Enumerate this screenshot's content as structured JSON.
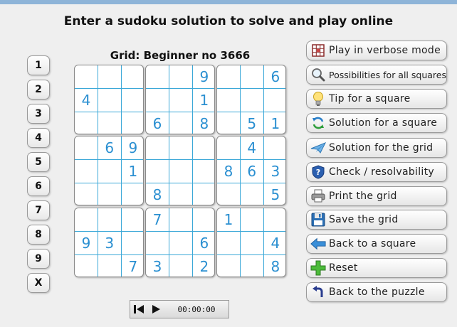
{
  "page": {
    "title": "Enter a sudoku solution to solve and play online"
  },
  "grid": {
    "title": "Grid: Beginner no 3666",
    "rows": [
      [
        "",
        "",
        "",
        "",
        "",
        "9",
        "",
        "",
        "6"
      ],
      [
        "4",
        "",
        "",
        "",
        "",
        "1",
        "",
        "",
        ""
      ],
      [
        "",
        "",
        "",
        "6",
        "",
        "8",
        "",
        "5",
        "1"
      ],
      [
        "",
        "6",
        "9",
        "",
        "",
        "",
        "",
        "4",
        ""
      ],
      [
        "",
        "",
        "1",
        "",
        "",
        "",
        "8",
        "6",
        "3"
      ],
      [
        "",
        "",
        "",
        "8",
        "",
        "",
        "",
        "",
        "5"
      ],
      [
        "",
        "",
        "",
        "7",
        "",
        "",
        "1",
        "",
        ""
      ],
      [
        "9",
        "3",
        "",
        "",
        "",
        "6",
        "",
        "",
        "4"
      ],
      [
        "",
        "",
        "7",
        "3",
        "",
        "2",
        "",
        "",
        "8"
      ]
    ],
    "digit_color": "#2a8fd1"
  },
  "numpad": [
    "1",
    "2",
    "3",
    "4",
    "5",
    "6",
    "7",
    "8",
    "9",
    "X"
  ],
  "actions": [
    {
      "label": "Play in verbose mode",
      "icon": "grid-icon",
      "name": "play-verbose-button"
    },
    {
      "label": "Possibilities for all squares",
      "icon": "magnifier-icon",
      "name": "possibilities-button"
    },
    {
      "label": "Tip for a square",
      "icon": "lightbulb-icon",
      "name": "tip-button"
    },
    {
      "label": "Solution for a square",
      "icon": "refresh-arrows-icon",
      "name": "solution-square-button"
    },
    {
      "label": "Solution for the grid",
      "icon": "paper-plane-icon",
      "name": "solution-grid-button"
    },
    {
      "label": "Check / resolvability",
      "icon": "shield-icon",
      "name": "check-button"
    },
    {
      "label": "Print the grid",
      "icon": "printer-icon",
      "name": "print-button"
    },
    {
      "label": "Save the grid",
      "icon": "floppy-disk-icon",
      "name": "save-button"
    },
    {
      "label": "Back to a square",
      "icon": "arrow-left-icon",
      "name": "back-square-button"
    },
    {
      "label": "Reset",
      "icon": "plus-icon",
      "name": "reset-button"
    },
    {
      "label": "Back to the puzzle",
      "icon": "arrow-return-icon",
      "name": "back-puzzle-button"
    }
  ],
  "player": {
    "timer": "00:00:00"
  }
}
